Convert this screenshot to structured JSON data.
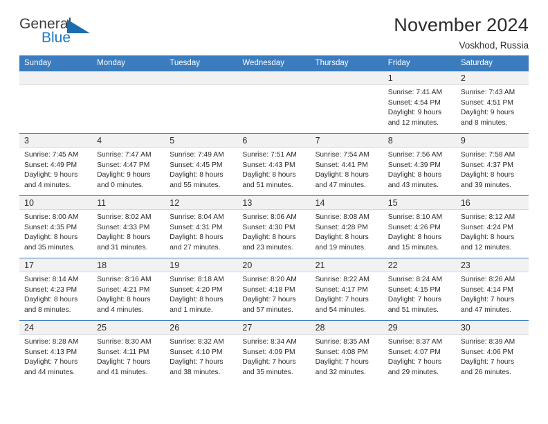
{
  "brand": {
    "name_top": "General",
    "name_bottom": "Blue",
    "accent_color": "#1b79c3",
    "triangle_color": "#1b6cb0"
  },
  "header": {
    "title": "November 2024",
    "subtitle": "Voskhod, Russia"
  },
  "theme": {
    "header_bar_color": "#3a7cbe",
    "daynum_band_color": "#f1f1f1",
    "text_color": "#2b2b2b"
  },
  "weekday_headers": [
    "Sunday",
    "Monday",
    "Tuesday",
    "Wednesday",
    "Thursday",
    "Friday",
    "Saturday"
  ],
  "weeks": [
    [
      {
        "day": "",
        "empty": true,
        "sunrise": "",
        "sunset": "",
        "daylight1": "",
        "daylight2": ""
      },
      {
        "day": "",
        "empty": true,
        "sunrise": "",
        "sunset": "",
        "daylight1": "",
        "daylight2": ""
      },
      {
        "day": "",
        "empty": true,
        "sunrise": "",
        "sunset": "",
        "daylight1": "",
        "daylight2": ""
      },
      {
        "day": "",
        "empty": true,
        "sunrise": "",
        "sunset": "",
        "daylight1": "",
        "daylight2": ""
      },
      {
        "day": "",
        "empty": true,
        "sunrise": "",
        "sunset": "",
        "daylight1": "",
        "daylight2": ""
      },
      {
        "day": "1",
        "sunrise": "Sunrise: 7:41 AM",
        "sunset": "Sunset: 4:54 PM",
        "daylight1": "Daylight: 9 hours",
        "daylight2": "and 12 minutes."
      },
      {
        "day": "2",
        "sunrise": "Sunrise: 7:43 AM",
        "sunset": "Sunset: 4:51 PM",
        "daylight1": "Daylight: 9 hours",
        "daylight2": "and 8 minutes."
      }
    ],
    [
      {
        "day": "3",
        "sunrise": "Sunrise: 7:45 AM",
        "sunset": "Sunset: 4:49 PM",
        "daylight1": "Daylight: 9 hours",
        "daylight2": "and 4 minutes."
      },
      {
        "day": "4",
        "sunrise": "Sunrise: 7:47 AM",
        "sunset": "Sunset: 4:47 PM",
        "daylight1": "Daylight: 9 hours",
        "daylight2": "and 0 minutes."
      },
      {
        "day": "5",
        "sunrise": "Sunrise: 7:49 AM",
        "sunset": "Sunset: 4:45 PM",
        "daylight1": "Daylight: 8 hours",
        "daylight2": "and 55 minutes."
      },
      {
        "day": "6",
        "sunrise": "Sunrise: 7:51 AM",
        "sunset": "Sunset: 4:43 PM",
        "daylight1": "Daylight: 8 hours",
        "daylight2": "and 51 minutes."
      },
      {
        "day": "7",
        "sunrise": "Sunrise: 7:54 AM",
        "sunset": "Sunset: 4:41 PM",
        "daylight1": "Daylight: 8 hours",
        "daylight2": "and 47 minutes."
      },
      {
        "day": "8",
        "sunrise": "Sunrise: 7:56 AM",
        "sunset": "Sunset: 4:39 PM",
        "daylight1": "Daylight: 8 hours",
        "daylight2": "and 43 minutes."
      },
      {
        "day": "9",
        "sunrise": "Sunrise: 7:58 AM",
        "sunset": "Sunset: 4:37 PM",
        "daylight1": "Daylight: 8 hours",
        "daylight2": "and 39 minutes."
      }
    ],
    [
      {
        "day": "10",
        "sunrise": "Sunrise: 8:00 AM",
        "sunset": "Sunset: 4:35 PM",
        "daylight1": "Daylight: 8 hours",
        "daylight2": "and 35 minutes."
      },
      {
        "day": "11",
        "sunrise": "Sunrise: 8:02 AM",
        "sunset": "Sunset: 4:33 PM",
        "daylight1": "Daylight: 8 hours",
        "daylight2": "and 31 minutes."
      },
      {
        "day": "12",
        "sunrise": "Sunrise: 8:04 AM",
        "sunset": "Sunset: 4:31 PM",
        "daylight1": "Daylight: 8 hours",
        "daylight2": "and 27 minutes."
      },
      {
        "day": "13",
        "sunrise": "Sunrise: 8:06 AM",
        "sunset": "Sunset: 4:30 PM",
        "daylight1": "Daylight: 8 hours",
        "daylight2": "and 23 minutes."
      },
      {
        "day": "14",
        "sunrise": "Sunrise: 8:08 AM",
        "sunset": "Sunset: 4:28 PM",
        "daylight1": "Daylight: 8 hours",
        "daylight2": "and 19 minutes."
      },
      {
        "day": "15",
        "sunrise": "Sunrise: 8:10 AM",
        "sunset": "Sunset: 4:26 PM",
        "daylight1": "Daylight: 8 hours",
        "daylight2": "and 15 minutes."
      },
      {
        "day": "16",
        "sunrise": "Sunrise: 8:12 AM",
        "sunset": "Sunset: 4:24 PM",
        "daylight1": "Daylight: 8 hours",
        "daylight2": "and 12 minutes."
      }
    ],
    [
      {
        "day": "17",
        "sunrise": "Sunrise: 8:14 AM",
        "sunset": "Sunset: 4:23 PM",
        "daylight1": "Daylight: 8 hours",
        "daylight2": "and 8 minutes."
      },
      {
        "day": "18",
        "sunrise": "Sunrise: 8:16 AM",
        "sunset": "Sunset: 4:21 PM",
        "daylight1": "Daylight: 8 hours",
        "daylight2": "and 4 minutes."
      },
      {
        "day": "19",
        "sunrise": "Sunrise: 8:18 AM",
        "sunset": "Sunset: 4:20 PM",
        "daylight1": "Daylight: 8 hours",
        "daylight2": "and 1 minute."
      },
      {
        "day": "20",
        "sunrise": "Sunrise: 8:20 AM",
        "sunset": "Sunset: 4:18 PM",
        "daylight1": "Daylight: 7 hours",
        "daylight2": "and 57 minutes."
      },
      {
        "day": "21",
        "sunrise": "Sunrise: 8:22 AM",
        "sunset": "Sunset: 4:17 PM",
        "daylight1": "Daylight: 7 hours",
        "daylight2": "and 54 minutes."
      },
      {
        "day": "22",
        "sunrise": "Sunrise: 8:24 AM",
        "sunset": "Sunset: 4:15 PM",
        "daylight1": "Daylight: 7 hours",
        "daylight2": "and 51 minutes."
      },
      {
        "day": "23",
        "sunrise": "Sunrise: 8:26 AM",
        "sunset": "Sunset: 4:14 PM",
        "daylight1": "Daylight: 7 hours",
        "daylight2": "and 47 minutes."
      }
    ],
    [
      {
        "day": "24",
        "sunrise": "Sunrise: 8:28 AM",
        "sunset": "Sunset: 4:13 PM",
        "daylight1": "Daylight: 7 hours",
        "daylight2": "and 44 minutes."
      },
      {
        "day": "25",
        "sunrise": "Sunrise: 8:30 AM",
        "sunset": "Sunset: 4:11 PM",
        "daylight1": "Daylight: 7 hours",
        "daylight2": "and 41 minutes."
      },
      {
        "day": "26",
        "sunrise": "Sunrise: 8:32 AM",
        "sunset": "Sunset: 4:10 PM",
        "daylight1": "Daylight: 7 hours",
        "daylight2": "and 38 minutes."
      },
      {
        "day": "27",
        "sunrise": "Sunrise: 8:34 AM",
        "sunset": "Sunset: 4:09 PM",
        "daylight1": "Daylight: 7 hours",
        "daylight2": "and 35 minutes."
      },
      {
        "day": "28",
        "sunrise": "Sunrise: 8:35 AM",
        "sunset": "Sunset: 4:08 PM",
        "daylight1": "Daylight: 7 hours",
        "daylight2": "and 32 minutes."
      },
      {
        "day": "29",
        "sunrise": "Sunrise: 8:37 AM",
        "sunset": "Sunset: 4:07 PM",
        "daylight1": "Daylight: 7 hours",
        "daylight2": "and 29 minutes."
      },
      {
        "day": "30",
        "sunrise": "Sunrise: 8:39 AM",
        "sunset": "Sunset: 4:06 PM",
        "daylight1": "Daylight: 7 hours",
        "daylight2": "and 26 minutes."
      }
    ]
  ]
}
